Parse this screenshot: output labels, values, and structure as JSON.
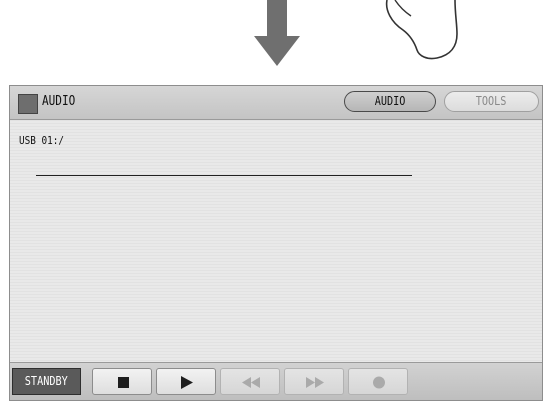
{
  "window": {
    "title": "AUDIO",
    "tabs": [
      {
        "label": "AUDIO",
        "active": true
      },
      {
        "label": "TOOLS",
        "active": false
      }
    ]
  },
  "browser": {
    "path": "USB 01:/"
  },
  "transport": {
    "standby_label": "STANDBY",
    "buttons": [
      {
        "icon": "stop-icon",
        "enabled": true
      },
      {
        "icon": "play-icon",
        "enabled": true
      },
      {
        "icon": "rewind-icon",
        "enabled": false
      },
      {
        "icon": "fast-forward-icon",
        "enabled": false
      },
      {
        "icon": "record-icon",
        "enabled": false
      }
    ]
  },
  "illustration": {
    "arrow": "down-arrow-icon",
    "hand": "touch-hand-icon"
  }
}
